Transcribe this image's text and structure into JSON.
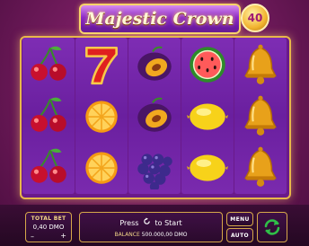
{
  "game": {
    "title": "Majestic Crown",
    "lines": "40"
  },
  "reels": [
    [
      "cherry-icon",
      "cherry-icon",
      "cherry-icon"
    ],
    [
      "seven-icon",
      "orange-icon",
      "orange-icon"
    ],
    [
      "plum-icon",
      "plum-icon",
      "grapes-icon"
    ],
    [
      "watermelon-icon",
      "lemon-icon",
      "lemon-icon"
    ],
    [
      "bell-icon",
      "bell-icon",
      "bell-icon"
    ]
  ],
  "hud": {
    "total_bet_label": "TOTAL BET",
    "total_bet_value": "0,40 DMO",
    "minus": "–",
    "plus": "+",
    "start_text": "Press",
    "start_text_2": "to Start",
    "balance_label": "BALANCE",
    "balance_value": "500.000,00 DMO",
    "menu_label": "MENU",
    "auto_label": "AUTO"
  },
  "colors": {
    "accent_gold": "#e8b74a",
    "reel_purple": "#6a1f9f",
    "spin_green": "#2fbf48"
  }
}
